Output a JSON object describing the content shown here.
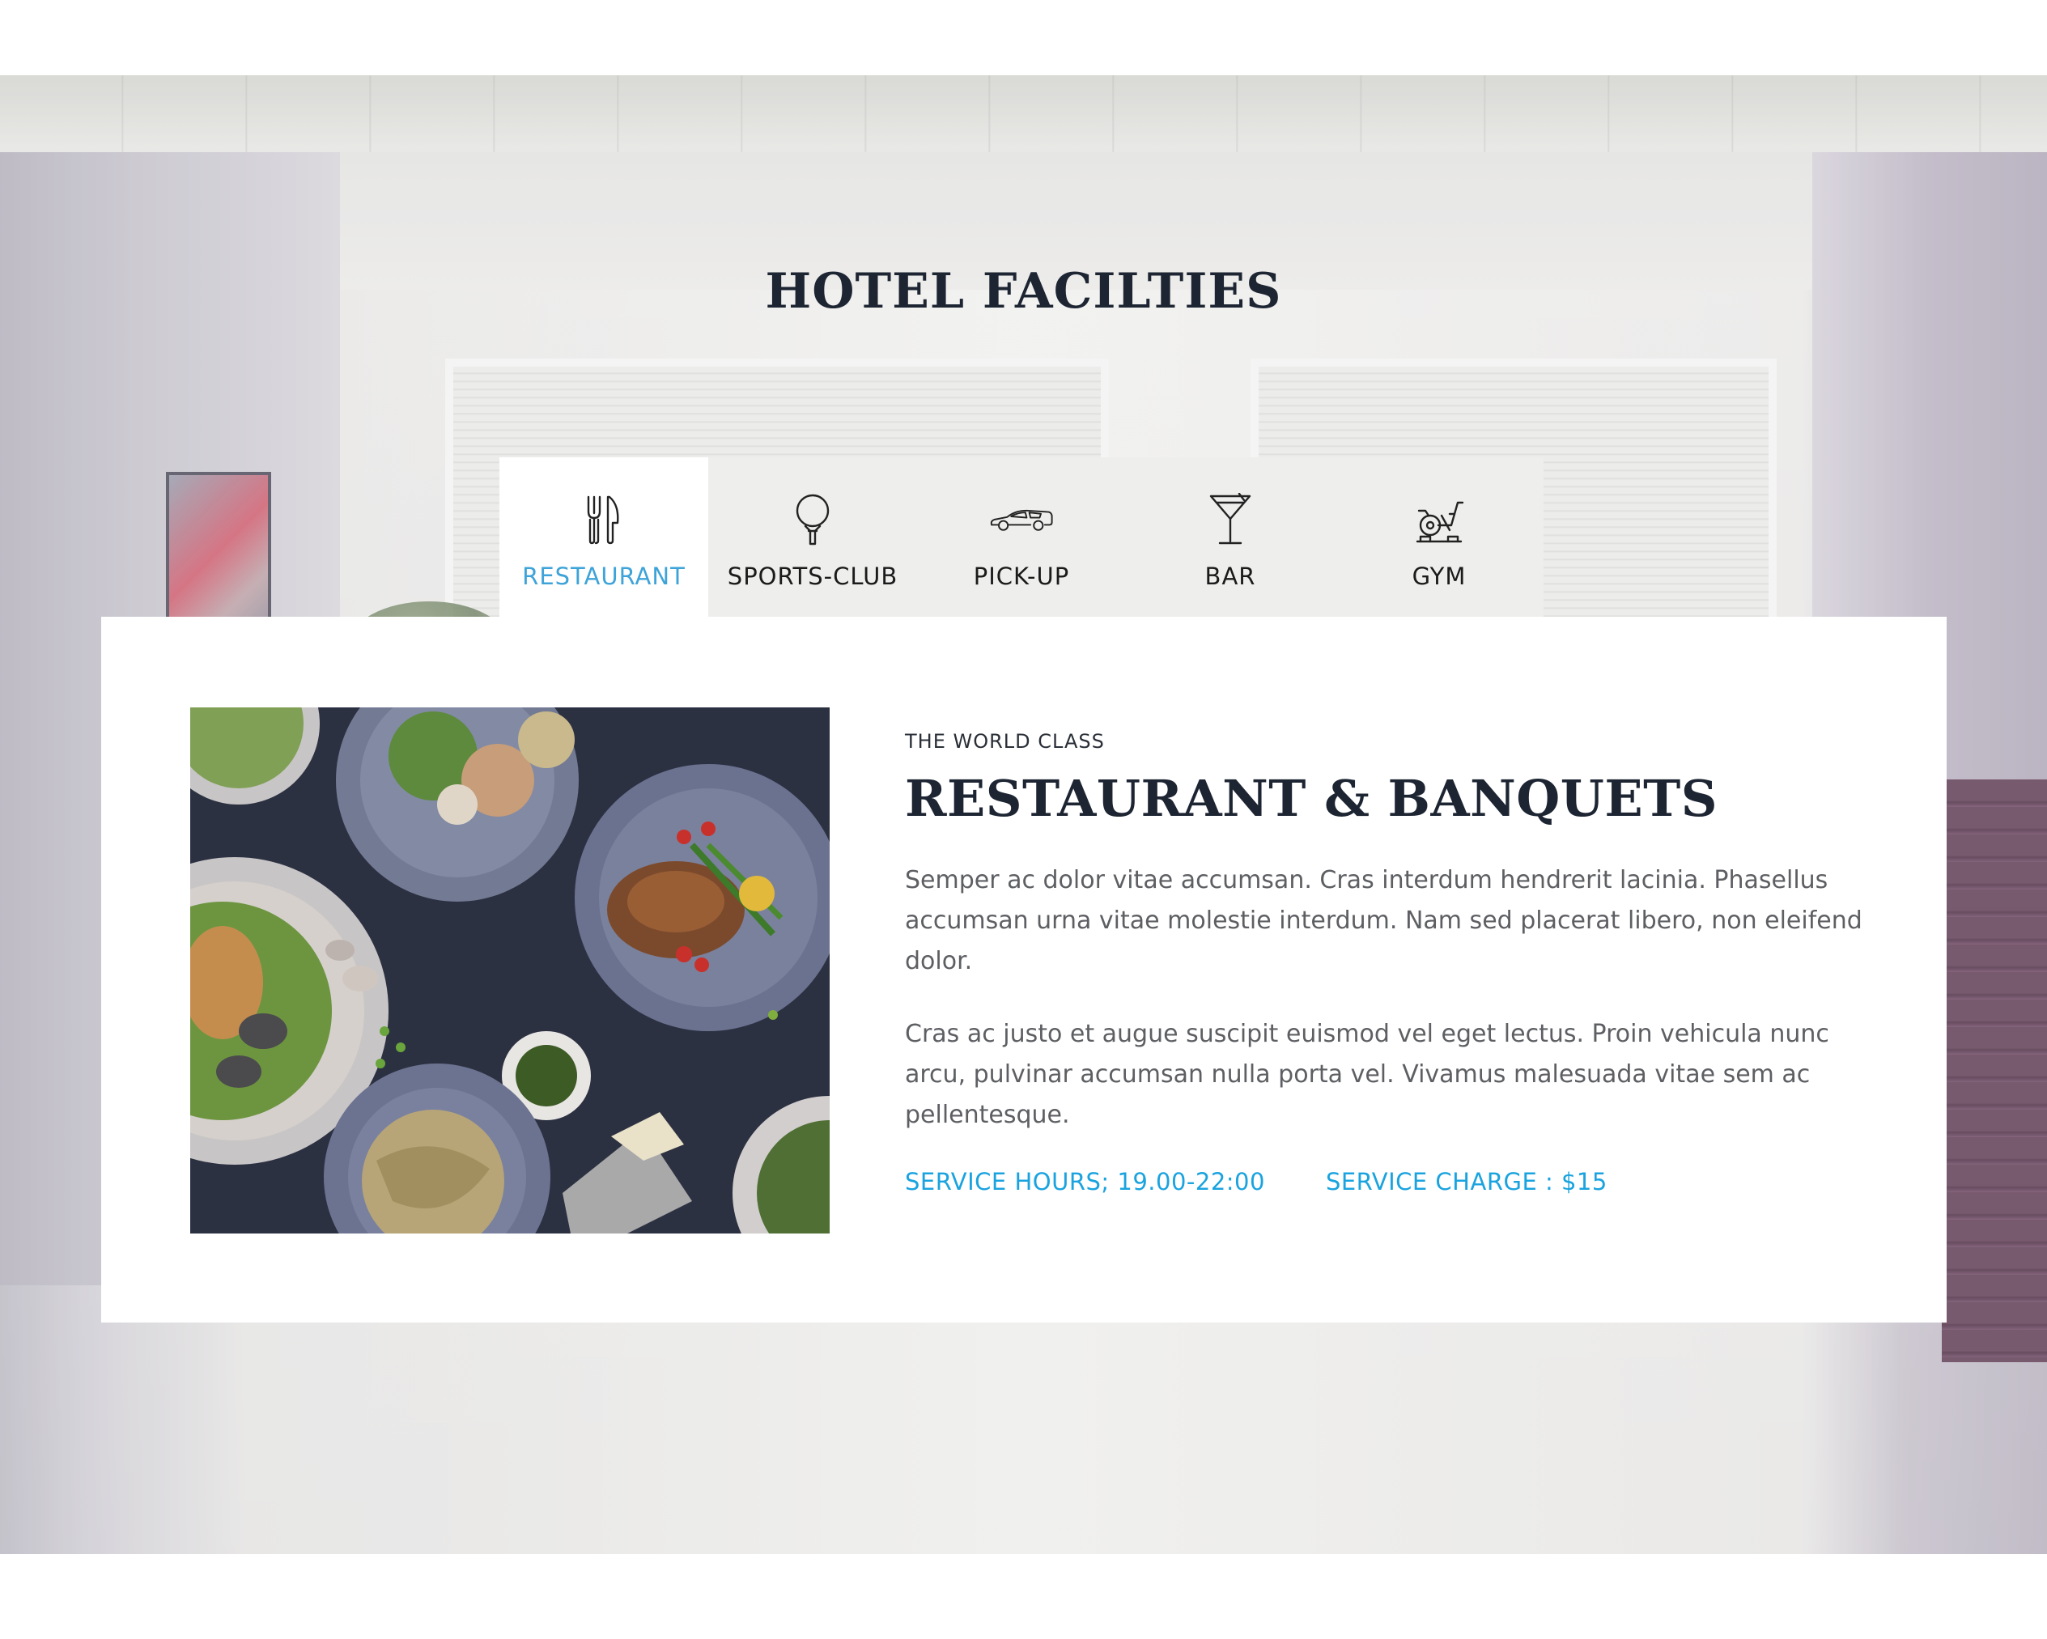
{
  "section": {
    "title": "HOTEL FACILTIES"
  },
  "tabs": [
    {
      "label": "RESTAURANT",
      "icon": "fork-knife-icon",
      "active": true
    },
    {
      "label": "SPORTS-CLUB",
      "icon": "golf-ball-icon",
      "active": false
    },
    {
      "label": "PICK-UP",
      "icon": "car-icon",
      "active": false
    },
    {
      "label": "BAR",
      "icon": "cocktail-glass-icon",
      "active": false
    },
    {
      "label": "GYM",
      "icon": "exercise-bike-icon",
      "active": false
    }
  ],
  "content": {
    "eyebrow": "THE WORLD CLASS",
    "heading": "RESTAURANT & BANQUETS",
    "paragraph_1": "Semper ac dolor vitae accumsan. Cras interdum hendrerit lacinia. Phasellus accumsan urna vitae molestie interdum. Nam sed placerat libero, non eleifend dolor.",
    "paragraph_2": "Cras ac justo et augue suscipit euismod vel eget lectus. Proin vehicula nunc arcu, pulvinar accumsan nulla porta vel. Vivamus malesuada vitae sem ac pellentesque.",
    "service_hours": "SERVICE HOURS; 19.00-22:00",
    "service_charge": "SERVICE CHARGE : $15"
  },
  "colors": {
    "accent": "#1aa3df",
    "active_tab_label": "#3ea3d8",
    "heading": "#1d2533",
    "body_text": "#5d5f63",
    "tab_bar_bg": "#eeeeec"
  }
}
